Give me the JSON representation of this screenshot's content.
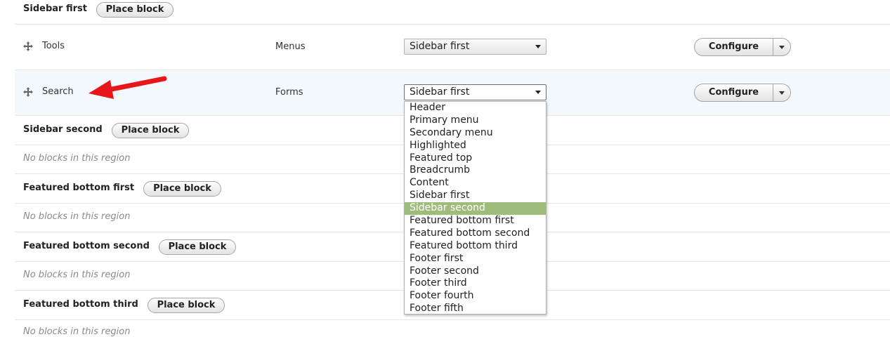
{
  "place_block_label": "Place block",
  "empty_region_text": "No blocks in this region",
  "configure_label": "Configure",
  "regions": {
    "sidebar_first": "Sidebar first",
    "sidebar_second": "Sidebar second",
    "featured_bottom_first": "Featured bottom first",
    "featured_bottom_second": "Featured bottom second",
    "featured_bottom_third": "Featured bottom third"
  },
  "blocks": [
    {
      "name": "Tools",
      "category": "Menus",
      "region": "Sidebar first"
    },
    {
      "name": "Search",
      "category": "Forms",
      "region": "Sidebar first"
    }
  ],
  "dropdown_options": [
    "Header",
    "Primary menu",
    "Secondary menu",
    "Highlighted",
    "Featured top",
    "Breadcrumb",
    "Content",
    "Sidebar first",
    "Sidebar second",
    "Featured bottom first",
    "Featured bottom second",
    "Featured bottom third",
    "Footer first",
    "Footer second",
    "Footer third",
    "Footer fourth",
    "Footer fifth"
  ],
  "dropdown_highlighted": "Sidebar second",
  "colors": {
    "highlight": "#9fbc7a",
    "annotation_arrow": "#e8161b",
    "active_row": "#f2f8fb"
  },
  "icons": {
    "drag_handle": "move-arrows-icon",
    "dropdown_toggle": "caret-down-icon",
    "annotation": "red-arrow-icon"
  }
}
